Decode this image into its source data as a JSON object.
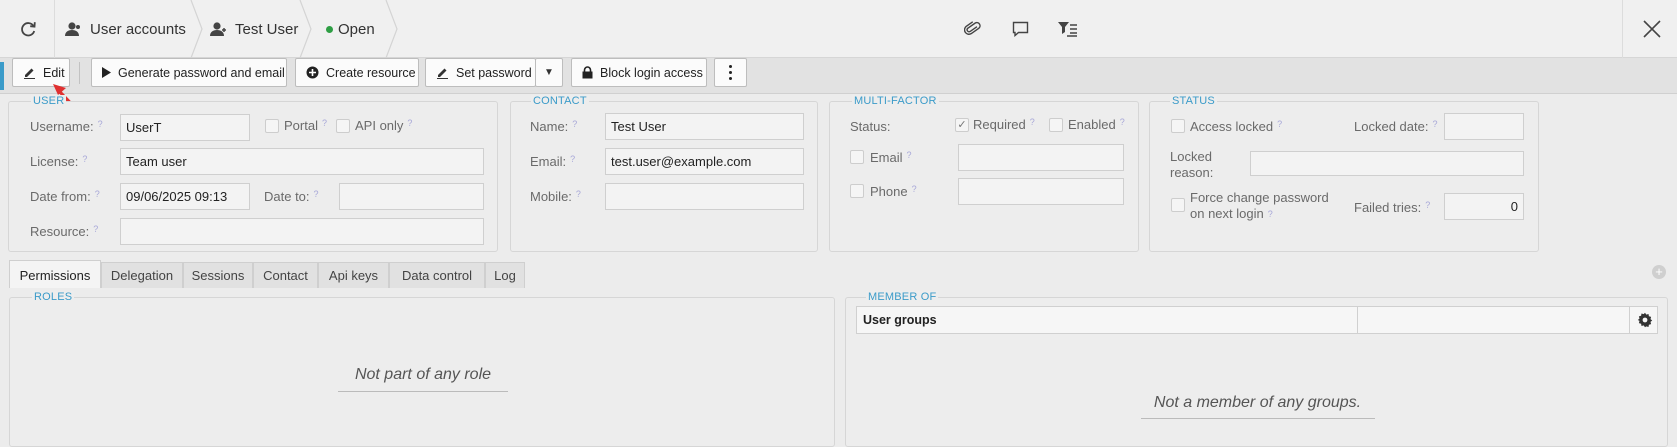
{
  "topbar": {
    "breadcrumb": [
      {
        "label": "User accounts",
        "icon": "user-group-icon"
      },
      {
        "label": "Test User",
        "icon": "user-icon"
      },
      {
        "label": "Open",
        "icon": "status-dot-icon",
        "status_color": "#2e9e44"
      }
    ],
    "actions": [
      "attachment-icon",
      "comment-icon",
      "filter-list-icon"
    ],
    "close_icon": "close-icon"
  },
  "toolbar": {
    "edit_label": "Edit",
    "generate_label": "Generate password and email",
    "create_resource_label": "Create resource",
    "set_password_label": "Set password",
    "block_login_label": "Block login access"
  },
  "user": {
    "title": "USER",
    "username_label": "Username:",
    "username": "UserT",
    "portal_label": "Portal",
    "api_only_label": "API only",
    "license_label": "License:",
    "license": "Team user",
    "date_from_label": "Date from:",
    "date_from": "09/06/2025 09:13",
    "date_to_label": "Date to:",
    "date_to": "",
    "resource_label": "Resource:",
    "resource": ""
  },
  "contact": {
    "title": "CONTACT",
    "name_label": "Name:",
    "name": "Test User",
    "email_label": "Email:",
    "email": "test.user@example.com",
    "mobile_label": "Mobile:",
    "mobile": ""
  },
  "mfa": {
    "title": "MULTI-FACTOR",
    "status_label": "Status:",
    "required_label": "Required",
    "required_checked": true,
    "enabled_label": "Enabled",
    "enabled_checked": false,
    "email_label": "Email",
    "phone_label": "Phone"
  },
  "status": {
    "title": "STATUS",
    "access_locked_label": "Access locked",
    "locked_date_label": "Locked date:",
    "locked_reason_label_1": "Locked",
    "locked_reason_label_2": "reason:",
    "force_change_label_1": "Force change password",
    "force_change_label_2": "on next login",
    "failed_tries_label": "Failed tries:",
    "failed_tries": "0"
  },
  "tabs": [
    "Permissions",
    "Delegation",
    "Sessions",
    "Contact",
    "Api keys",
    "Data control",
    "Log"
  ],
  "active_tab": "Permissions",
  "roles": {
    "title": "ROLES",
    "empty_text": "Not part of any role"
  },
  "member_of": {
    "title": "MEMBER OF",
    "column_header": "User groups",
    "empty_text": "Not a member of any groups."
  },
  "colors": {
    "accent": "#3b9bc9",
    "status_open": "#2e9e44",
    "pointer_arrow": "#e03030"
  }
}
